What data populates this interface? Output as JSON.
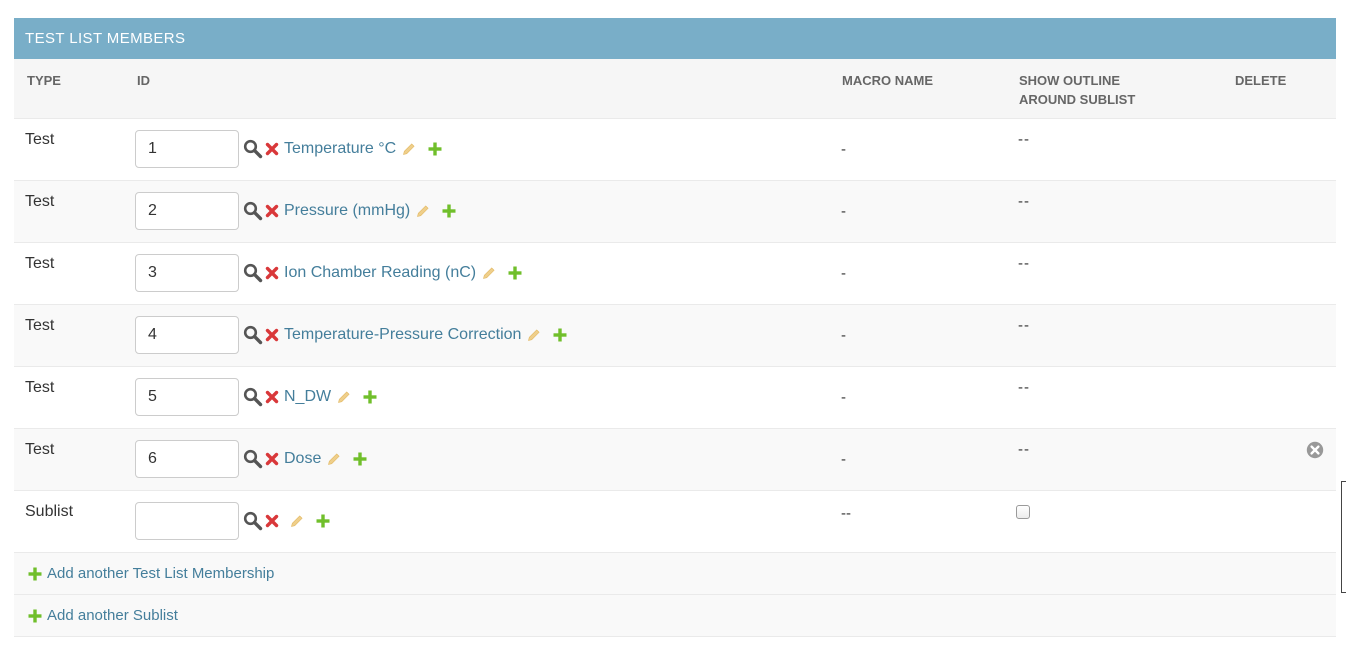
{
  "module": {
    "caption": "TEST LIST MEMBERS"
  },
  "columns": {
    "type": "TYPE",
    "id": "ID",
    "macro_name": "MACRO NAME",
    "show_outline_line1": "SHOW OUTLINE",
    "show_outline_line2": "AROUND SUBLIST",
    "delete": "DELETE"
  },
  "rows": [
    {
      "type": "Test",
      "id": "1",
      "name": "Temperature °C",
      "macro_name": "-",
      "show_outline": "--"
    },
    {
      "type": "Test",
      "id": "2",
      "name": "Pressure (mmHg)",
      "macro_name": "-",
      "show_outline": "--"
    },
    {
      "type": "Test",
      "id": "3",
      "name": "Ion Chamber Reading (nC)",
      "macro_name": "-",
      "show_outline": "--"
    },
    {
      "type": "Test",
      "id": "4",
      "name": "Temperature-Pressure Correction",
      "macro_name": "-",
      "show_outline": "--"
    },
    {
      "type": "Test",
      "id": "5",
      "name": "N_DW",
      "macro_name": "-",
      "show_outline": "--"
    },
    {
      "type": "Test",
      "id": "6",
      "name": "Dose",
      "macro_name": "-",
      "show_outline": "--"
    },
    {
      "type": "Sublist",
      "id": "",
      "name": "",
      "macro_name": "--",
      "show_outline_checked": false
    }
  ],
  "actions": {
    "add_membership": "Add another Test List Membership",
    "add_sublist": "Add another Sublist"
  },
  "colors": {
    "header": "#79aec8",
    "link": "#447e9b",
    "delete_x": "#d9383a",
    "add_plus": "#70bf2b",
    "pencil": "#efcf8b"
  },
  "icons": {
    "lookup": "magnifier-icon",
    "remove": "red-x-icon",
    "change": "pencil-icon",
    "add": "plus-icon",
    "delete_row": "circle-x-icon"
  }
}
